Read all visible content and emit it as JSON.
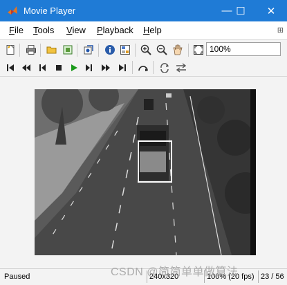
{
  "window": {
    "title": "Movie Player",
    "minimize_glyph": "—",
    "maximize_glyph": "☐",
    "close_glyph": "✕"
  },
  "menu": [
    {
      "mnemonic": "F",
      "rest": "ile"
    },
    {
      "mnemonic": "T",
      "rest": "ools"
    },
    {
      "mnemonic": "V",
      "rest": "iew"
    },
    {
      "mnemonic": "P",
      "rest": "layback"
    },
    {
      "mnemonic": "H",
      "rest": "elp"
    }
  ],
  "pin_glyph": "⊞",
  "toolbar": {
    "icons": [
      "new-document-icon",
      "print-icon",
      "open-folder-icon",
      "import-icon",
      "export-icon",
      "info-icon",
      "properties-icon",
      "zoom-in-icon",
      "zoom-out-icon",
      "pan-hand-icon",
      "fit-to-window-icon"
    ],
    "zoom_value": "100%"
  },
  "playback": {
    "buttons": [
      "go-to-first-icon",
      "rewind-icon",
      "step-back-icon",
      "stop-icon",
      "play-icon",
      "step-forward-icon",
      "fast-forward-icon",
      "go-to-last-icon",
      "jump-to-icon",
      "loop-icon",
      "playback-direction-icon"
    ]
  },
  "status": {
    "state": "Paused",
    "size": "240x320",
    "zoom_fps": "100% (20 fps)",
    "frame": "23 / 56"
  },
  "watermark": "CSDN @简简单单做算法",
  "colors": {
    "titlebar": "#1f7bd6",
    "roi_box": "#ffffff",
    "play_green": "#1a9a1a"
  }
}
